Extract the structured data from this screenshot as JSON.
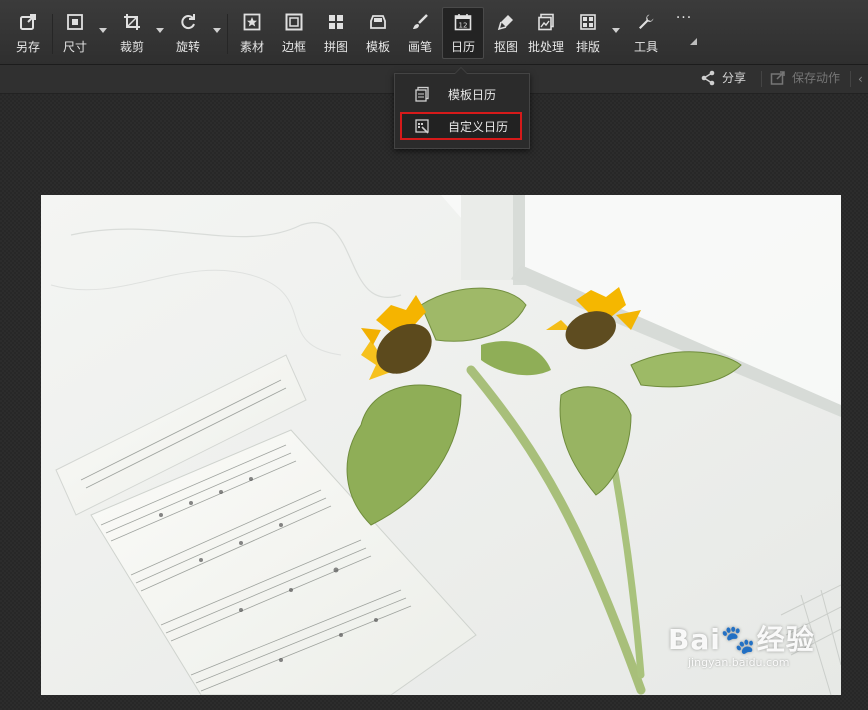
{
  "toolbar": {
    "items": [
      {
        "label": "另存",
        "icon": "save-as-icon"
      },
      {
        "label": "尺寸",
        "icon": "resize-icon",
        "has_dropdown": true
      },
      {
        "label": "裁剪",
        "icon": "crop-icon",
        "has_dropdown": true
      },
      {
        "label": "旋转",
        "icon": "rotate-icon",
        "has_dropdown": true
      },
      {
        "label": "素材",
        "icon": "star-material-icon"
      },
      {
        "label": "边框",
        "icon": "frame-icon"
      },
      {
        "label": "拼图",
        "icon": "collage-icon"
      },
      {
        "label": "模板",
        "icon": "template-icon"
      },
      {
        "label": "画笔",
        "icon": "brush-icon"
      },
      {
        "label": "日历",
        "icon": "calendar-icon",
        "active": true
      },
      {
        "label": "抠图",
        "icon": "cutout-pen-icon"
      },
      {
        "label": "批处理",
        "icon": "batch-icon"
      },
      {
        "label": "排版",
        "icon": "layout-icon",
        "has_dropdown": true
      },
      {
        "label": "工具",
        "icon": "wrench-icon"
      },
      {
        "label": "···",
        "icon": "more-icon"
      }
    ],
    "calendar_icon_number": "12"
  },
  "secondary_bar": {
    "share_label": "分享",
    "save_action_label": "保存动作"
  },
  "calendar_menu": {
    "items": [
      {
        "label": "模板日历",
        "icon": "template-calendar-icon"
      },
      {
        "label": "自定义日历",
        "icon": "custom-calendar-icon",
        "highlighted": true,
        "highlight_color": "#d61a1a"
      }
    ]
  },
  "watermark": {
    "brand": "Bai🐾经验",
    "url": "jingyan.baidu.com"
  },
  "photo": {
    "subject": "sunflowers-on-sheet-music"
  }
}
